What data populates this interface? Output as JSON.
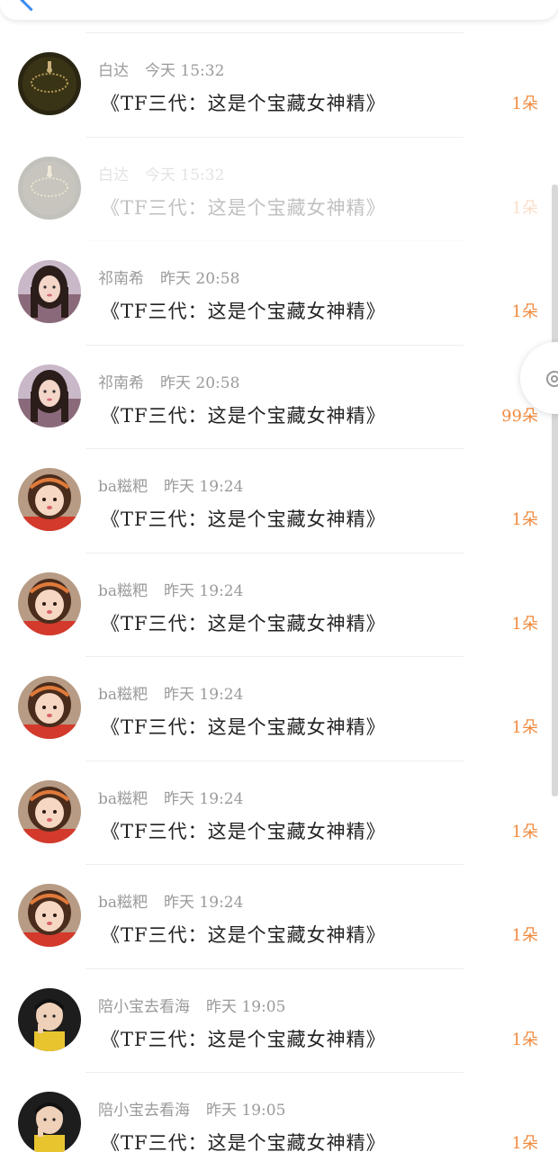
{
  "header": {
    "title": ""
  },
  "messages": [
    {
      "name": "白达",
      "time": "今天 15:32",
      "text": "《TF三代：这是个宝藏女神精》",
      "count": "1朵",
      "avatar": "dark-rosary",
      "faded": false
    },
    {
      "name": "白达",
      "time": "今天 15:32",
      "text": "《TF三代：这是个宝藏女神精》",
      "count": "1朵",
      "avatar": "dark-rosary",
      "faded": true
    },
    {
      "name": "祁南希",
      "time": "昨天 20:58",
      "text": "《TF三代：这是个宝藏女神精》",
      "count": "1朵",
      "avatar": "girl-long-hair",
      "faded": false
    },
    {
      "name": "祁南希",
      "time": "昨天 20:58",
      "text": "《TF三代：这是个宝藏女神精》",
      "count": "99朵",
      "avatar": "girl-long-hair",
      "faded": false
    },
    {
      "name": "ba糍粑",
      "time": "昨天 19:24",
      "text": "《TF三代：这是个宝藏女神精》",
      "count": "1朵",
      "avatar": "child-headband",
      "faded": false
    },
    {
      "name": "ba糍粑",
      "time": "昨天 19:24",
      "text": "《TF三代：这是个宝藏女神精》",
      "count": "1朵",
      "avatar": "child-headband",
      "faded": false
    },
    {
      "name": "ba糍粑",
      "time": "昨天 19:24",
      "text": "《TF三代：这是个宝藏女神精》",
      "count": "1朵",
      "avatar": "child-headband",
      "faded": false
    },
    {
      "name": "ba糍粑",
      "time": "昨天 19:24",
      "text": "《TF三代：这是个宝藏女神精》",
      "count": "1朵",
      "avatar": "child-headband",
      "faded": false
    },
    {
      "name": "ba糍粑",
      "time": "昨天 19:24",
      "text": "《TF三代：这是个宝藏女神精》",
      "count": "1朵",
      "avatar": "child-headband",
      "faded": false
    },
    {
      "name": "陪小宝去看海",
      "time": "昨天 19:05",
      "text": "《TF三代：这是个宝藏女神精》",
      "count": "1朵",
      "avatar": "boy-yellow-shirt",
      "faded": false
    },
    {
      "name": "陪小宝去看海",
      "time": "昨天 19:05",
      "text": "《TF三代：这是个宝藏女神精》",
      "count": "1朵",
      "avatar": "boy-yellow-shirt",
      "faded": false
    }
  ],
  "colors": {
    "accent": "#f08a3e",
    "back": "#3b8cf5",
    "meta": "#9a9a9a",
    "text": "#222222"
  },
  "icons": {
    "back": "back-arrow-icon",
    "float": "flower-icon"
  }
}
